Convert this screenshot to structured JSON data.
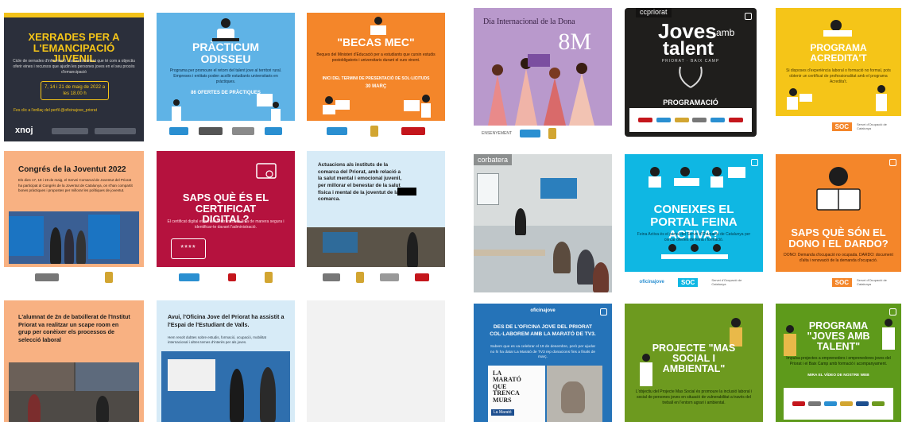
{
  "tiles": {
    "t1": {
      "title": "XERRADES PER A L'EMANCIPACIÓ JUVENIL",
      "body": "Cicle de xerrades d'informació i assessorament que té com a objectiu oferir eines i recursos que ajudin les persones joves en el seu procés d'emancipació",
      "date": "7, 14 i 21 de maig de 2022 a les 18.00 h",
      "link_note": "Fes clic a l'enllaç del perfil @oficinajove_priorat",
      "brand": "xnoj"
    },
    "t2": {
      "title": "PRÀCTICUM ODISSEU",
      "body": "Programa per promoure el retorn del talent jove al territori rural. Empreses i entitats poden acollir estudiants universitaris en pràctiques.",
      "highlight": "86 OFERTES DE PRÀCTIQUES"
    },
    "t3": {
      "title": "\"BECAS MEC\"",
      "body": "Beques del Ministeri d'Educació per a estudiants que cursin estudis postobligatoris i universitaris durant el curs vinent.",
      "highlight": "INICI DEL TERMINI DE PRESENTACIÓ DE SOL·LICITUDS",
      "date": "30 MARÇ"
    },
    "t4": {
      "heading": "Dia Internacional de la Dona",
      "big": "8M",
      "footer": "ENSENYEMENT"
    },
    "t5": {
      "title_line1": "Joves",
      "title_sub": "amb",
      "title_line2": "talent",
      "tagline": "PRIORAT · BAIX CAMP",
      "label": "PROGRAMACIÓ",
      "username": "ccpriorat"
    },
    "t6": {
      "title": "PROGRAMA ACREDITA'T",
      "body": "Si disposes d'experiència laboral o formació no formal, pots obtenir un certificat de professionalitat amb el programa Acredita't."
    },
    "t7": {
      "heading": "Congrés de la Joventut 2022",
      "body": "Els dies 17, 18 i 19 de maig, el Servei Comarcal de Joventut del Priorat ha participat al Congrés de la Joventut de Catalunya, on s'han compartit bones pràctiques i propostes per millorar les polítiques de joventut."
    },
    "t8": {
      "title": "SAPS QUÈ ÉS EL CERTIFICAT DIGITAL?",
      "body": "El certificat digital et permet fer tràmits en línia de manera segura i identificar-te davant l'administració.",
      "pin": "****"
    },
    "t9": {
      "heading": "Actuacions als instituts de la comarca del Priorat, amb relació a la salut mental i emocional juvenil, per millorar el benestar de la salut física i mental de la joventut de la comarca."
    },
    "t10": {
      "username": "corbatera"
    },
    "t11": {
      "title": "CONEIXES EL PORTAL FEINA ACTIVA?",
      "body": "Feina Activa és el portal del Servei d'Ocupació de Catalunya per cercar ofertes de feina i formació."
    },
    "t12": {
      "title": "SAPS QUÈ SÓN EL DONO I EL DARDO?",
      "body": "DONO: Demanda d'ocupació no ocupada. DARDO: document d'alta i renovació de la demanda d'ocupació."
    },
    "t13": {
      "heading": "L'alumnat de 2n de batxillerat de l'Institut Priorat va realitzar un scape room en grup per conèixer els processos de selecció laboral"
    },
    "t14": {
      "heading": "Avui, l'Oficina Jove del Priorat ha assistit a l'Espai de l'Estudiant de Valls.",
      "body": "Hem resolt dubtes sobre estudis, formació, ocupació, mobilitat internacional i altres temes d'interès per als joves."
    },
    "t16": {
      "heading": "DES DE L'OFICINA JOVE DEL PRIORAT COL·LABOREM AMB LA MARATÓ DE TV3.",
      "body": "Sabem que es va celebrar el 19 de desembre, però per ajudar no hi ha data! La Marató de TV3 rep donacions fins a finals de març.",
      "marato": "LA MARATÓ QUE TRENCA MURS",
      "tv3": "La Marató"
    },
    "t17": {
      "title": "PROJECTE \"MAS SOCIAL I AMBIENTAL\"",
      "body": "L'objectiu del Projecte Mas Social és promoure la inclusió laboral i social de persones joves en situació de vulnerabilitat a través del treball en l'entorn agrari i ambiental."
    },
    "t18": {
      "title": "PROGRAMA \"JOVES AMB TALENT\"",
      "body": "Impulsa projectes a emprenedors i emprenedores joves del Priorat i el Baix Camp amb formació i acompanyament.",
      "link": "MIRA EL VÍDEO DE NOSTRE WEB"
    }
  },
  "logos": {
    "oficina": "oficinajove",
    "soc": "SOC",
    "soc_desc": "Servei d'Ocupació de Catalunya"
  },
  "colors": {
    "navy": "#2a2f3d",
    "yellow": "#f5c518",
    "sky": "#5fb3e6",
    "orange": "#f4862a",
    "lilac": "#b898cc",
    "crimson": "#b5123e",
    "peach": "#f7b07e",
    "light_blue": "#d8ecf8",
    "olive": "#6d9a1f",
    "green": "#5e9a1b",
    "cyan": "#0fb7e3"
  }
}
